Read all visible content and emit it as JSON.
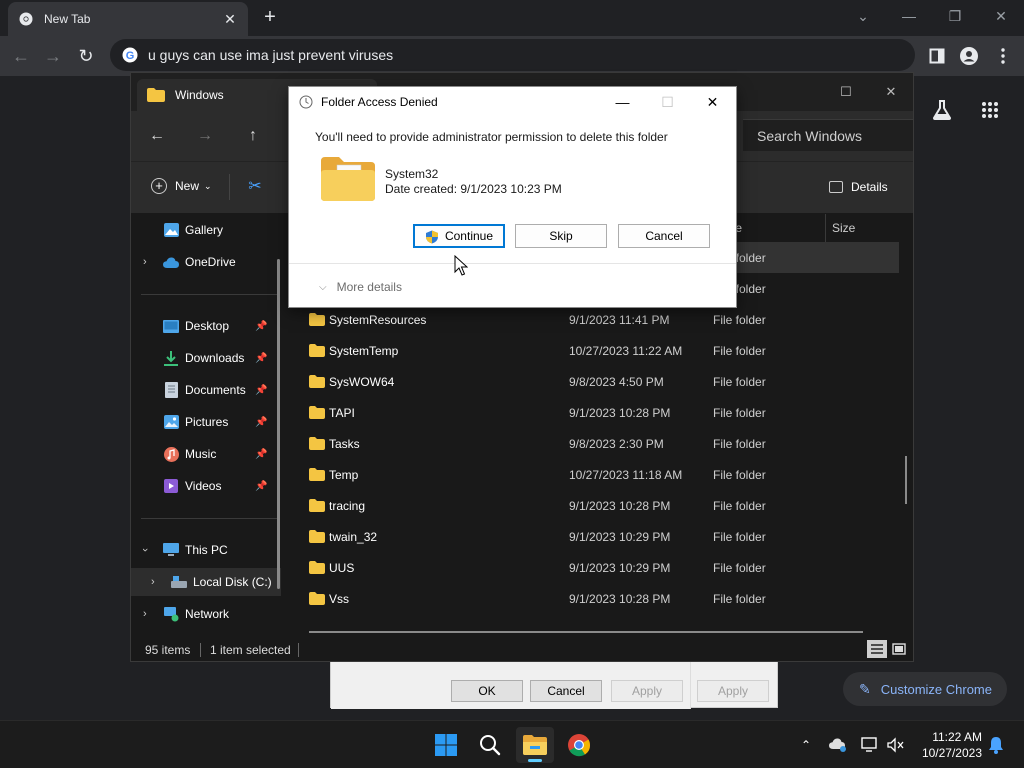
{
  "chrome": {
    "tab_title": "New Tab",
    "omnibox_text": "u guys can use ima just prevent viruses",
    "customize_label": "Customize Chrome"
  },
  "explorer": {
    "tab_title": "Windows",
    "search_placeholder": "Search Windows",
    "new_label": "New",
    "details_label": "Details",
    "columns": {
      "type": "Type",
      "size": "Size"
    },
    "sidebar": {
      "gallery": "Gallery",
      "onedrive": "OneDrive",
      "desktop": "Desktop",
      "downloads": "Downloads",
      "documents": "Documents",
      "pictures": "Pictures",
      "music": "Music",
      "videos": "Videos",
      "this_pc": "This PC",
      "local_disk": "Local Disk (C:)",
      "network": "Network"
    },
    "visible_row_types": [
      "File folder",
      "File folder"
    ],
    "rows": [
      {
        "name": "SystemResources",
        "date": "9/1/2023 11:41 PM",
        "type": "File folder"
      },
      {
        "name": "SystemTemp",
        "date": "10/27/2023 11:22 AM",
        "type": "File folder"
      },
      {
        "name": "SysWOW64",
        "date": "9/8/2023 4:50 PM",
        "type": "File folder"
      },
      {
        "name": "TAPI",
        "date": "9/1/2023 10:28 PM",
        "type": "File folder"
      },
      {
        "name": "Tasks",
        "date": "9/8/2023 2:30 PM",
        "type": "File folder"
      },
      {
        "name": "Temp",
        "date": "10/27/2023 11:18 AM",
        "type": "File folder"
      },
      {
        "name": "tracing",
        "date": "9/1/2023 10:28 PM",
        "type": "File folder"
      },
      {
        "name": "twain_32",
        "date": "9/1/2023 10:29 PM",
        "type": "File folder"
      },
      {
        "name": "UUS",
        "date": "9/1/2023 10:29 PM",
        "type": "File folder"
      },
      {
        "name": "Vss",
        "date": "9/1/2023 10:28 PM",
        "type": "File folder"
      }
    ],
    "status_items": "95 items",
    "status_selected": "1 item selected"
  },
  "dialog": {
    "title": "Folder Access Denied",
    "message": "You'll need to provide administrator permission to delete this folder",
    "folder_name": "System32",
    "date_created": "Date created: 9/1/2023 10:23 PM",
    "continue_label": "Continue",
    "skip_label": "Skip",
    "cancel_label": "Cancel",
    "more_details_label": "More details"
  },
  "properties": {
    "ok_label": "OK",
    "cancel_label": "Cancel",
    "apply_label": "Apply",
    "apply2_label": "Apply"
  },
  "taskbar": {
    "time": "11:22 AM",
    "date": "10/27/2023"
  },
  "colors": {
    "accent": "#0078d4",
    "chrome_accent": "#8ab4f8",
    "folder": "#f4c542"
  }
}
